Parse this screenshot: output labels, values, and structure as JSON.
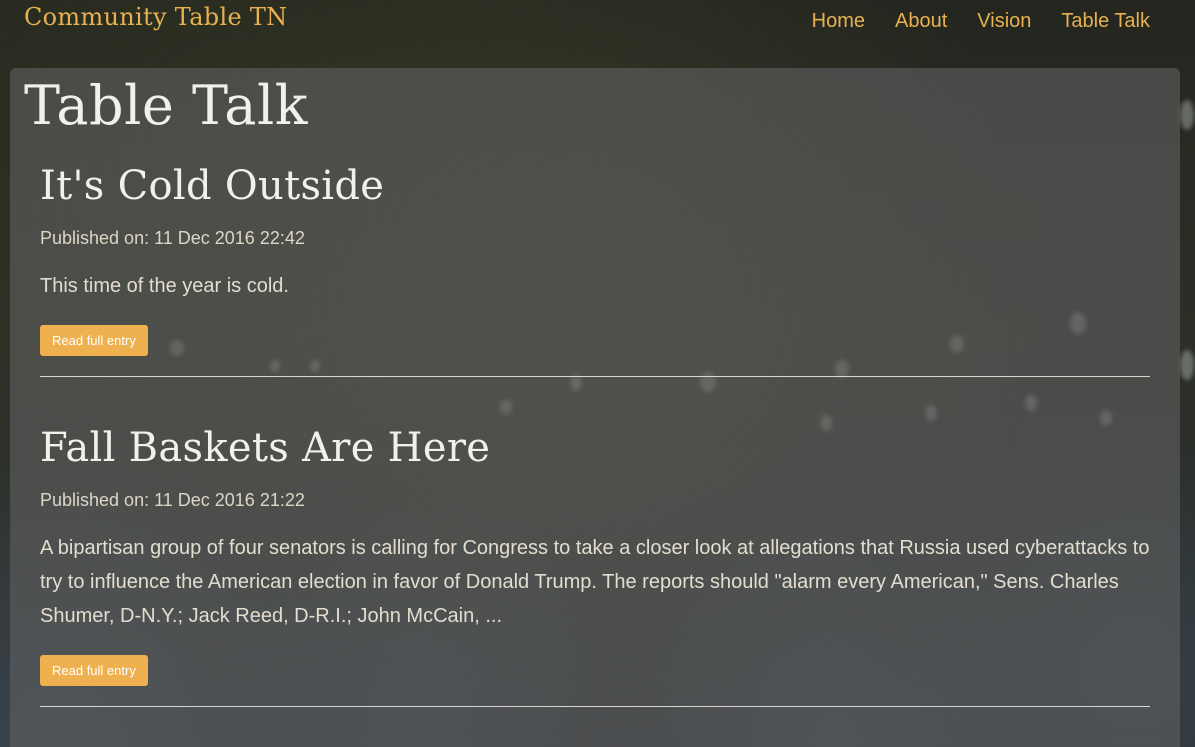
{
  "site": {
    "brand": "Community Table TN"
  },
  "nav": {
    "items": [
      {
        "label": "Home"
      },
      {
        "label": "About"
      },
      {
        "label": "Vision"
      },
      {
        "label": "Table Talk"
      }
    ]
  },
  "page": {
    "title": "Table Talk"
  },
  "posts": [
    {
      "title": "It's Cold Outside",
      "published": "Published on: 11 Dec 2016 22:42",
      "excerpt": "This time of the year is cold.",
      "button_label": "Read full entry"
    },
    {
      "title": "Fall Baskets Are Here",
      "published": "Published on: 11 Dec 2016 21:22",
      "excerpt": "A bipartisan group of four senators is calling for Congress to take a closer look at allegations that Russia used cyberattacks to try to influence the American election in favor of Donald Trump. The reports should \"alarm every American,\" Sens. Charles Shumer, D-N.Y.; Jack Reed, D-R.I.; John McCain, ...",
      "button_label": "Read full entry"
    }
  ],
  "colors": {
    "accent": "#e8b14f",
    "button": "#efb150",
    "panel": "#5f5f5f",
    "title_text": "#f2f0ec"
  }
}
